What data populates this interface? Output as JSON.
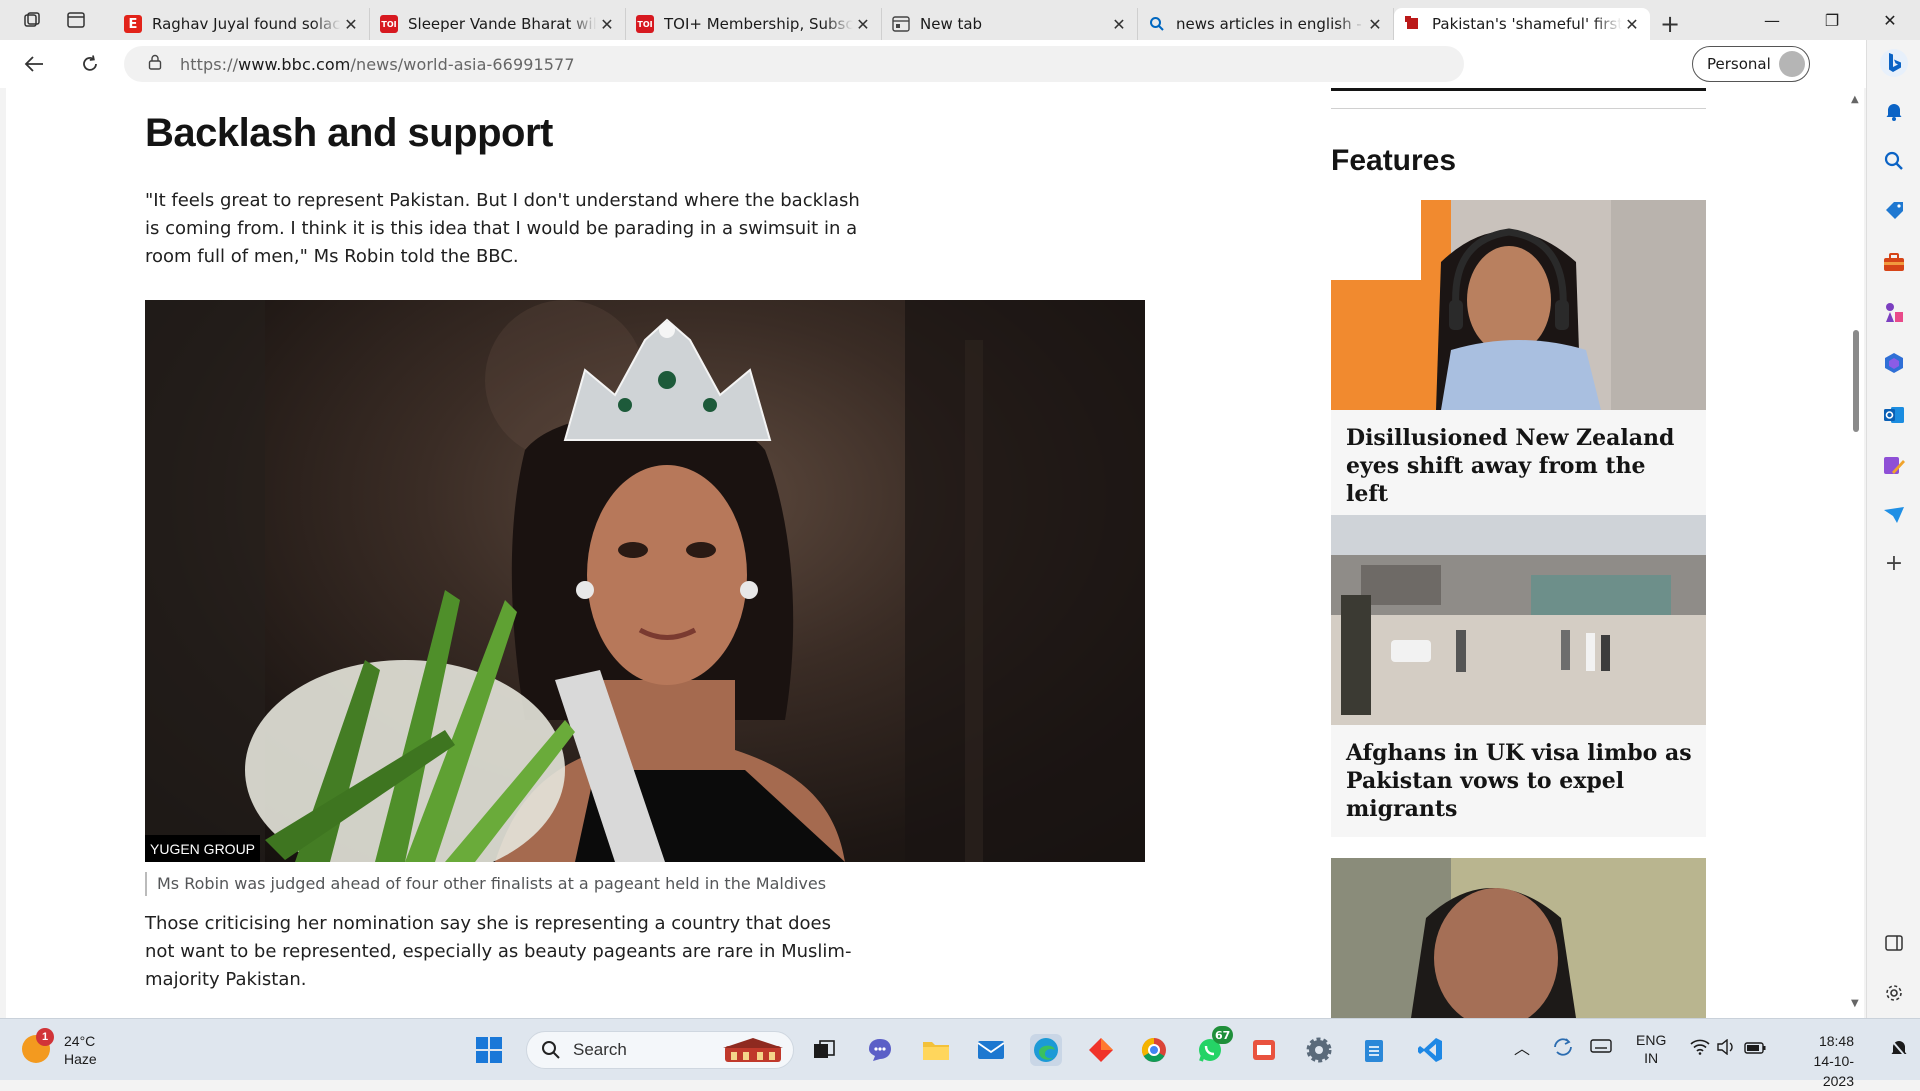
{
  "browser": {
    "tabs": [
      {
        "title": "Raghav Juyal found solace in",
        "favicon": "E",
        "favicon_color": "#e2231a",
        "active": false
      },
      {
        "title": "Sleeper Vande Bharat will cha",
        "favicon": "TOI",
        "favicon_color": "#d71920",
        "active": false
      },
      {
        "title": "TOI+ Membership, Subscripti",
        "favicon": "TOI",
        "favicon_color": "#d71920",
        "active": false
      },
      {
        "title": "New tab",
        "favicon": "newtab-icon",
        "favicon_color": "#444444",
        "active": false
      },
      {
        "title": "news articles in english - Sea",
        "favicon": "search-icon",
        "favicon_color": "#0067c0",
        "active": false
      },
      {
        "title": "Pakistan's 'shameful' first Mis",
        "favicon": "bbc-icon",
        "favicon_color": "#bb1919",
        "active": true
      }
    ],
    "url_prefix": "https://",
    "url_host": "www.bbc.com",
    "url_path": "/news/world-asia-66991577",
    "profile_label": "Personal"
  },
  "article": {
    "heading": "Backlash and support",
    "para1": "\"It feels great to represent Pakistan. But I don't understand where the backlash is coming from. I think it is this idea that I would be parading in a swimsuit in a room full of men,\" Ms Robin told the BBC.",
    "image_credit": "YUGEN GROUP",
    "caption": "Ms Robin was judged ahead of four other finalists at a pageant held in the Maldives",
    "para2": "Those criticising her nomination say she is representing a country that does not want to be represented, especially as beauty pageants are rare in Muslim-majority Pakistan."
  },
  "sidebar_content": {
    "section_title": "Features",
    "cards": [
      {
        "title": "Disillusioned New Zealand eyes shift away from the left"
      },
      {
        "title": "Afghans in UK visa limbo as Pakistan vows to expel migrants"
      }
    ]
  },
  "taskbar": {
    "weather_temp": "24°C",
    "weather_desc": "Haze",
    "weather_badge": "1",
    "search_label": "Search",
    "whatsapp_badge": "67",
    "lang_1": "ENG",
    "lang_2": "IN",
    "time": "18:48",
    "date": "14-10-2023"
  },
  "colors": {
    "bbc_red": "#bb1919",
    "edge_accent": "#0067c0",
    "taskbar_bg": "#dfe6ee"
  }
}
